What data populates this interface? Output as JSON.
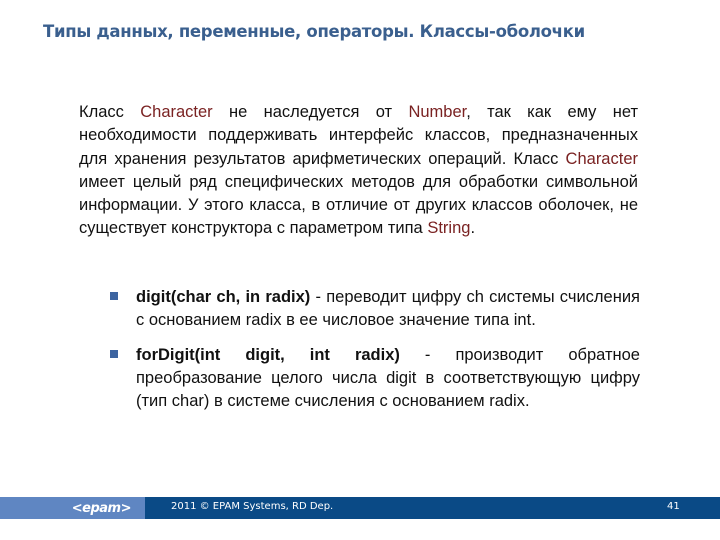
{
  "slide": {
    "title": "Типы данных, переменные, операторы. Классы-оболочки",
    "paragraph": {
      "parts": [
        {
          "text": "Класс ",
          "highlight": false
        },
        {
          "text": "Character",
          "highlight": true
        },
        {
          "text": " не наследуется от ",
          "highlight": false
        },
        {
          "text": "Number",
          "highlight": true
        },
        {
          "text": ", так как ему нет необходимости поддерживать интерфейс классов, предназначенных для хранения результатов арифметических операций. Класс ",
          "highlight": false
        },
        {
          "text": "Character",
          "highlight": true
        },
        {
          "text": " имеет целый ряд специфических методов для обработки символьной информации. У этого класса, в отличие от других классов оболочек, не существует конструктора с параметром типа ",
          "highlight": false
        },
        {
          "text": "String",
          "highlight": true
        },
        {
          "text": ".",
          "highlight": false
        }
      ]
    },
    "bullets": [
      {
        "method": "digit(char ch, in radix)",
        "description": " - переводит цифру ch системы счисления с основанием radix в ее числовое значение типа int."
      },
      {
        "method": "forDigit(int digit, int radix)",
        "description": "  - производит обратное преобразование целого числа digit в соответствующую цифру (тип char) в системе счисления с основанием radix."
      }
    ]
  },
  "footer": {
    "logo": "<epam>",
    "copyright": "2011 © EPAM Systems, RD Dep.",
    "page_number": "41"
  },
  "colors": {
    "title": "#3a5f8e",
    "highlight": "#7a2222",
    "bullet": "#3d64a0",
    "footer_left": "#5f86c2",
    "footer_right": "#0a4a86"
  }
}
